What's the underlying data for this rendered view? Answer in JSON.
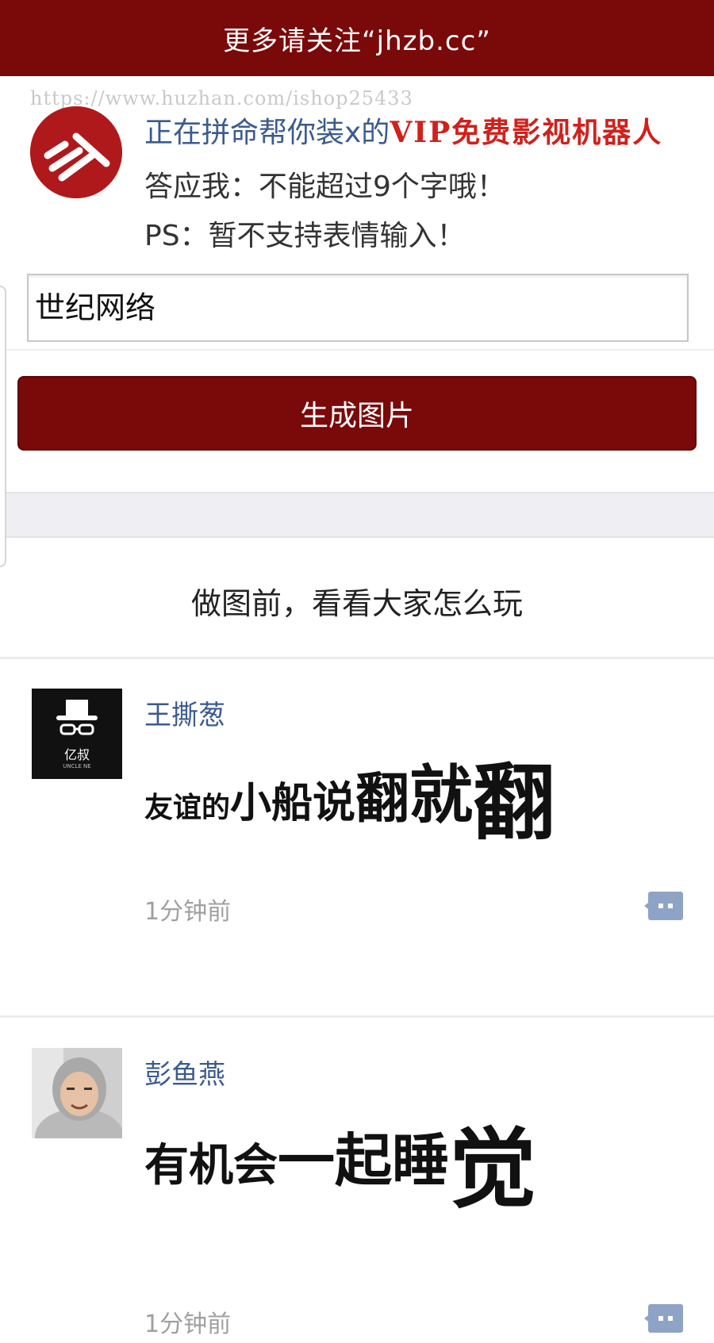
{
  "header": {
    "title": "更多请关注“jhzb.cc”"
  },
  "banner": {
    "watermark": "https://www.huzhan.com/ishop25433",
    "line1_text": "正在拼命帮你装x的",
    "line1_vip": "VIP免费影视机器人",
    "line2": "答应我：不能超过9个字哦！",
    "line3": "PS：暂不支持表情输入！"
  },
  "form": {
    "input_value": "世纪网络",
    "generate_label": "生成图片"
  },
  "gallery": {
    "title": "做图前，看看大家怎么玩",
    "posts": [
      {
        "username": "王撕葱",
        "avatar_text": "亿叔",
        "avatar_subtext": "UNCLE NE",
        "text_parts": [
          "友谊的",
          "小船",
          "说",
          "翻",
          "就",
          "翻"
        ],
        "time": "1分钟前"
      },
      {
        "username": "彭鱼燕",
        "text_parts": [
          "有机会",
          "一起睡",
          "觉"
        ],
        "time": "1分钟前"
      }
    ]
  },
  "colors": {
    "brand": "#7a0909",
    "link": "#3b5b8e",
    "vip": "#d0211c",
    "icon": "#8fa3c6"
  },
  "icons": {
    "comment": "comment-bubble-icon"
  }
}
